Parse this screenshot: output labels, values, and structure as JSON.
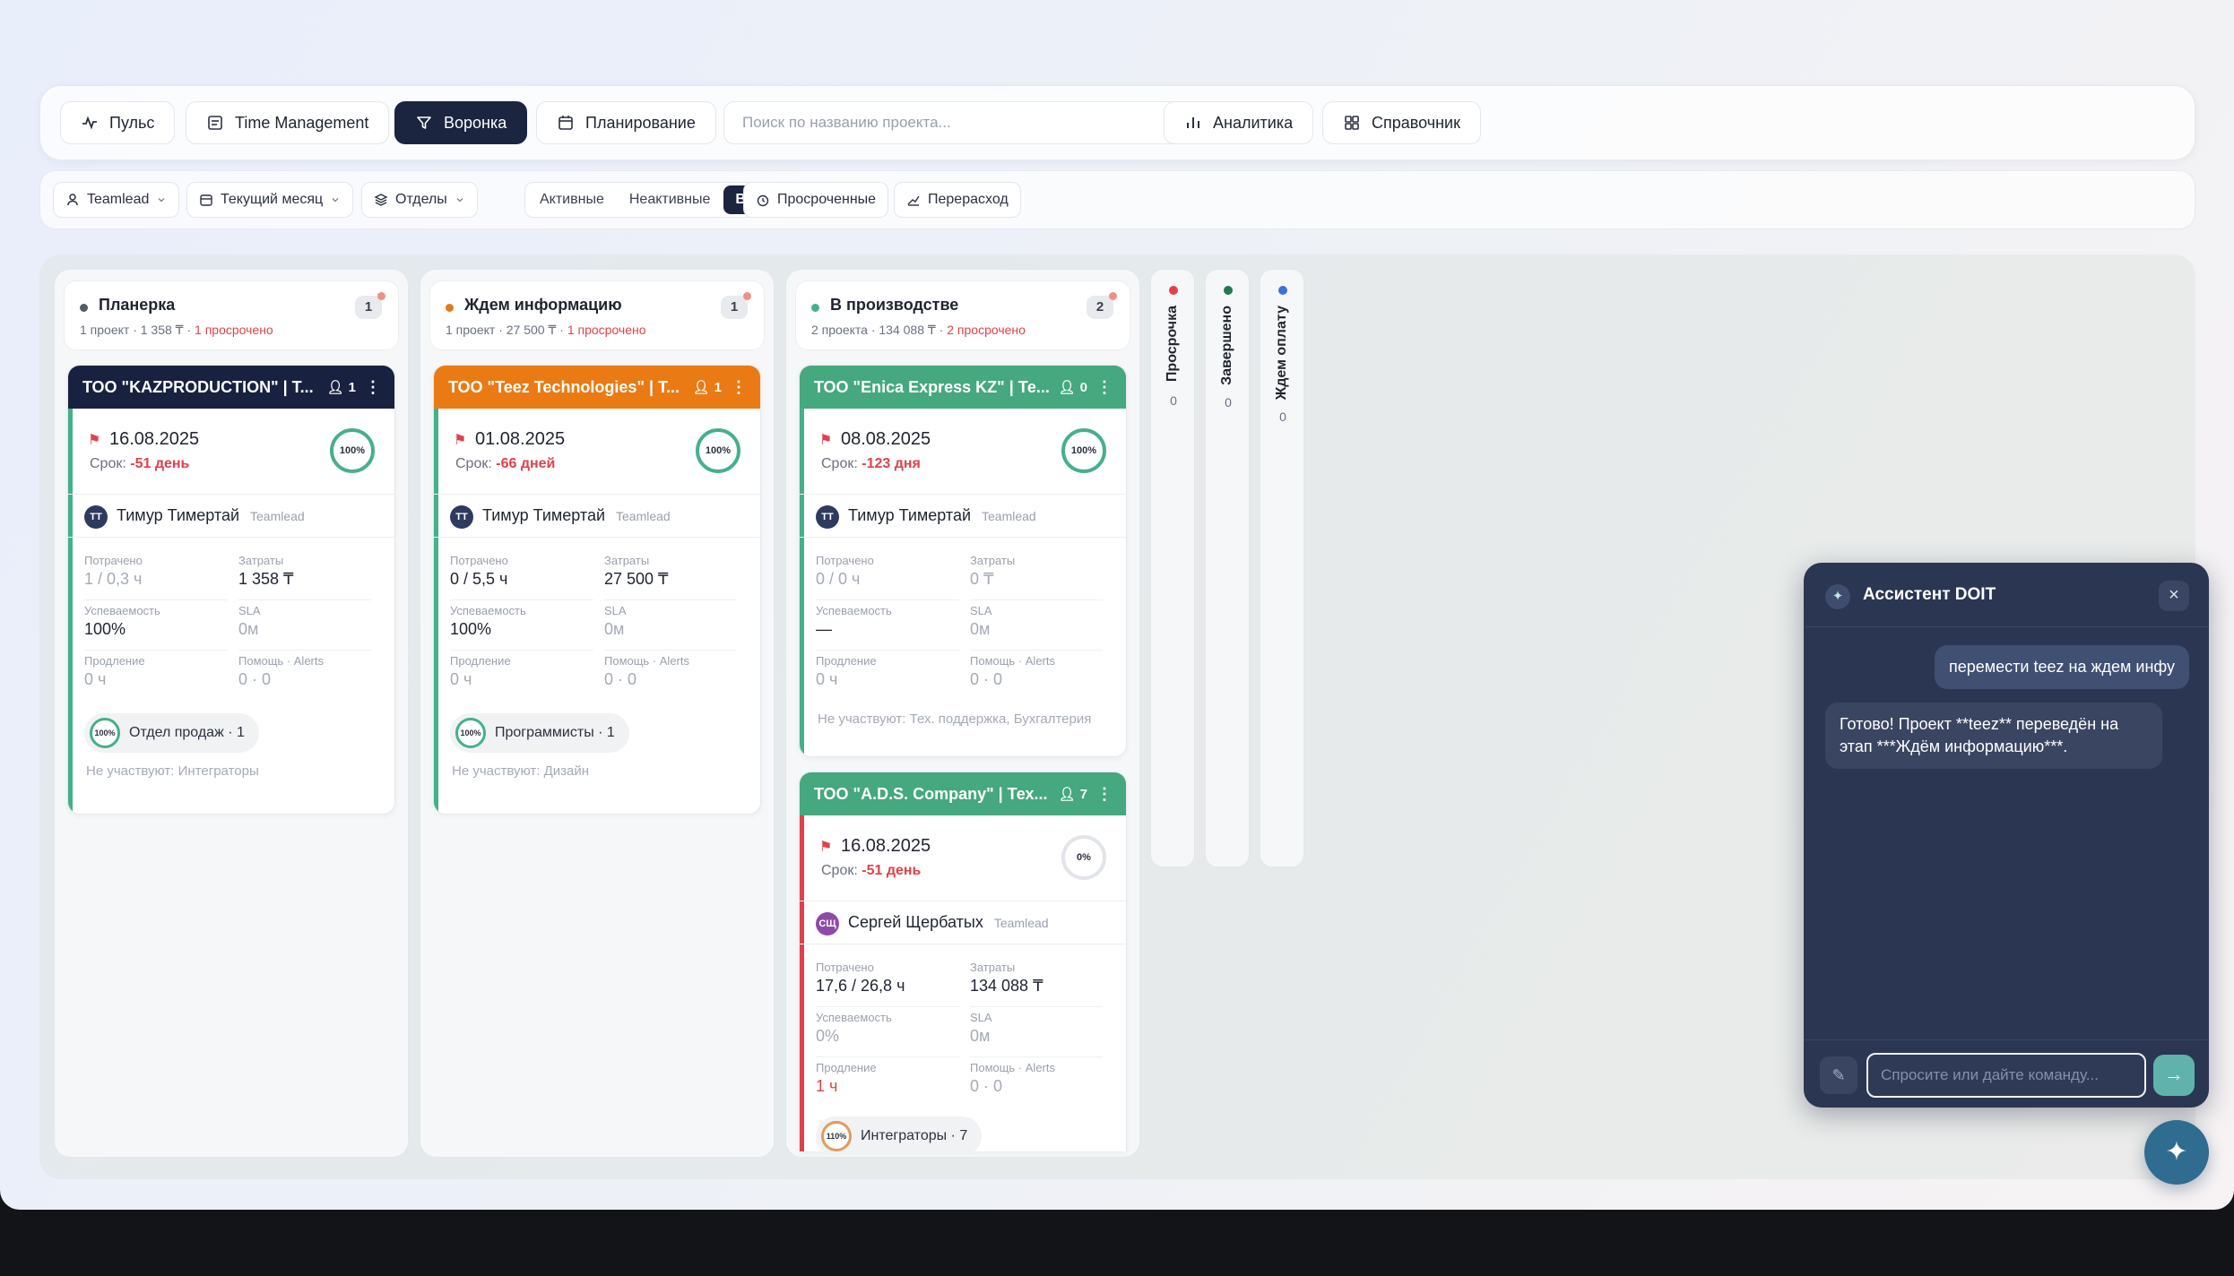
{
  "nav": {
    "pulse": "Пульс",
    "time_management": "Time Management",
    "funnel": "Воронка",
    "planning": "Планирование",
    "search_placeholder": "Поиск по названию проекта...",
    "analytics": "Аналитика",
    "reference": "Справочник",
    "active_tab": "Воронка"
  },
  "filters": {
    "teamlead": "Teamlead",
    "period": "Текущий месяц",
    "departments": "Отделы",
    "status_segments": [
      "Активные",
      "Неактивные",
      "Все"
    ],
    "status_selected": "Все",
    "overdue": "Просроченные",
    "overspend": "Перерасход"
  },
  "columns": [
    {
      "title": "Планерка",
      "dot_color": "#555b66",
      "summary": "1 проект · 1 358 ₸ · ",
      "overdue_text": "1 просрочено",
      "count": "1",
      "cards": [
        {
          "name": "ТОО \"KAZPRODUCTION\" | Т...",
          "participants": "1",
          "header_color": "#18213f",
          "accent_color": "#45b08a",
          "deadline": "16.08.2025",
          "srok_label": "Срок:",
          "srok_value": "-51 день",
          "progress": "100%",
          "avatar": "ТТ",
          "avatar_color": "#2e3a5e",
          "person": "Тимур Тимертай",
          "role": "Teamlead",
          "metrics": {
            "spent_label": "Потрачено",
            "spent": "1 / 0,3 ч",
            "cost_label": "Затраты",
            "cost": "1 358 ₸",
            "perf_label": "Успеваемость",
            "perf": "100%",
            "sla_label": "SLA",
            "sla": "0м",
            "ext_label": "Продление",
            "ext": "0 ч",
            "help_label": "Помощь · Alerts",
            "help": "0 · 0"
          },
          "dept_progress": "100%",
          "dept": "Отдел продаж · 1",
          "not_participating": "Не участвуют: Интеграторы"
        }
      ]
    },
    {
      "title": "Ждем информацию",
      "dot_color": "#e07a1e",
      "summary": "1 проект · 27 500 ₸ · ",
      "overdue_text": "1 просрочено",
      "count": "1",
      "cards": [
        {
          "name": "ТОО \"Teez Technologies\" | Т...",
          "participants": "1",
          "header_color": "#ea7a14",
          "accent_color": "#45b08a",
          "deadline": "01.08.2025",
          "srok_label": "Срок:",
          "srok_value": "-66 дней",
          "progress": "100%",
          "avatar": "ТТ",
          "avatar_color": "#2e3a5e",
          "person": "Тимур Тимертай",
          "role": "Teamlead",
          "metrics": {
            "spent_label": "Потрачено",
            "spent": "0 / 5,5 ч",
            "cost_label": "Затраты",
            "cost": "27 500 ₸",
            "perf_label": "Успеваемость",
            "perf": "100%",
            "sla_label": "SLA",
            "sla": "0м",
            "ext_label": "Продление",
            "ext": "0 ч",
            "help_label": "Помощь · Alerts",
            "help": "0 · 0"
          },
          "dept_progress": "100%",
          "dept": "Программисты · 1",
          "not_participating": "Не участвуют: Дизайн"
        }
      ]
    },
    {
      "title": "В производстве",
      "dot_color": "#45b08a",
      "summary": "2 проекта · 134 088 ₸ · ",
      "overdue_text": "2 просрочено",
      "count": "2",
      "cards": [
        {
          "name": "ТОО \"Enica Express KZ\" | Те...",
          "participants": "0",
          "header_color": "#45a87f",
          "accent_color": "#45b08a",
          "deadline": "08.08.2025",
          "srok_label": "Срок:",
          "srok_value": "-123 дня",
          "progress": "100%",
          "avatar": "ТТ",
          "avatar_color": "#2e3a5e",
          "person": "Тимур Тимертай",
          "role": "Teamlead",
          "metrics": {
            "spent_label": "Потрачено",
            "spent": "0 / 0 ч",
            "cost_label": "Затраты",
            "cost": "0 ₸",
            "perf_label": "Успеваемость",
            "perf": "—",
            "sla_label": "SLA",
            "sla": "0м",
            "ext_label": "Продление",
            "ext": "0 ч",
            "help_label": "Помощь · Alerts",
            "help": "0 · 0"
          },
          "not_participating": "Не участвуют: Тех. поддержка, Бухгалтерия"
        },
        {
          "name": "ТОО \"A.D.S. Company\" | Тех...",
          "participants": "7",
          "header_color": "#45a87f",
          "accent_color": "#e0414b",
          "deadline": "16.08.2025",
          "srok_label": "Срок:",
          "srok_value": "-51 день",
          "progress": "0%",
          "avatar": "СЩ",
          "avatar_color": "#8e4aa8",
          "person": "Сергей Щербатых",
          "role": "Teamlead",
          "metrics": {
            "spent_label": "Потрачено",
            "spent": "17,6 / 26,8 ч",
            "cost_label": "Затраты",
            "cost": "134 088 ₸",
            "perf_label": "Успеваемость",
            "perf": "0%",
            "sla_label": "SLA",
            "sla": "0м",
            "ext_label": "Продление",
            "ext": "1 ч",
            "help_label": "Помощь · Alerts",
            "help": "0 · 0"
          },
          "dept_progress": "110%",
          "dept": "Интеграторы · 7"
        }
      ]
    }
  ],
  "collapsed_columns": [
    {
      "title": "Просрочка",
      "count": "0",
      "dot_color": "#e0414b"
    },
    {
      "title": "Завершено",
      "count": "0",
      "dot_color": "#1f7a4f"
    },
    {
      "title": "Ждем оплату",
      "count": "0",
      "dot_color": "#3b6fe0"
    }
  ],
  "assistant": {
    "title": "Ассистент DOIT",
    "close": "×",
    "user_message": "перемести teez на ждем инфу",
    "assistant_message": "Готово! Проект **teez** переведён на этап ***Ждём информацию***.",
    "input_placeholder": "Спросите или дайте команду...",
    "send_icon": "→"
  },
  "fab_icon": "✦"
}
